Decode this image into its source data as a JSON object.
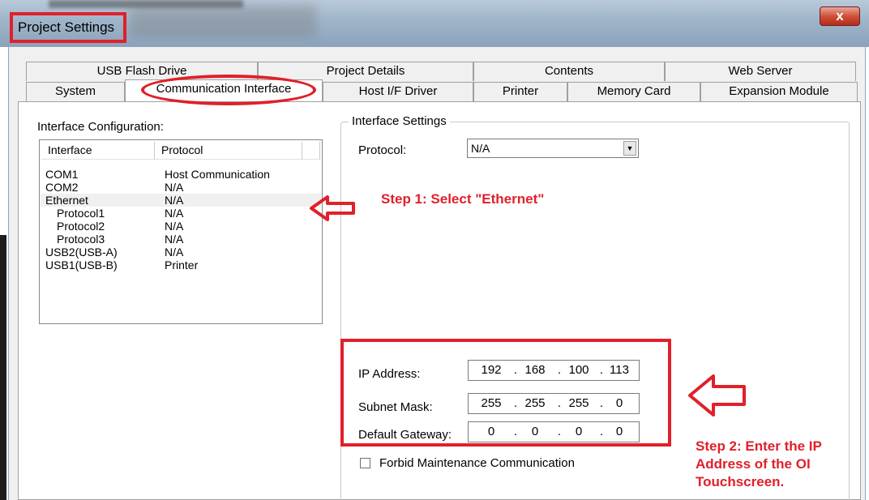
{
  "window": {
    "title": "Project Settings",
    "close_label": "x"
  },
  "tabs_row1": [
    "USB Flash Drive",
    "Project Details",
    "Contents",
    "Web Server"
  ],
  "tabs_row2": [
    "System",
    "Communication Interface",
    "Host I/F Driver",
    "Printer",
    "Memory Card",
    "Expansion Module"
  ],
  "interface_config": {
    "label": "Interface Configuration:",
    "headers": [
      "Interface",
      "Protocol"
    ],
    "rows": [
      {
        "interface": "COM1",
        "protocol": "Host Communication"
      },
      {
        "interface": "COM2",
        "protocol": "N/A"
      },
      {
        "interface": "Ethernet",
        "protocol": "N/A"
      },
      {
        "interface": "Protocol1",
        "protocol": "N/A"
      },
      {
        "interface": "Protocol2",
        "protocol": "N/A"
      },
      {
        "interface": "Protocol3",
        "protocol": "N/A"
      },
      {
        "interface": "USB2(USB-A)",
        "protocol": "N/A"
      },
      {
        "interface": "USB1(USB-B)",
        "protocol": "Printer"
      }
    ]
  },
  "interface_settings": {
    "title": "Interface Settings",
    "protocol_label": "Protocol:",
    "protocol_value": "N/A",
    "ip_label": "IP Address:",
    "ip": [
      "192",
      "168",
      "100",
      "113"
    ],
    "subnet_label": "Subnet Mask:",
    "subnet": [
      "255",
      "255",
      "255",
      "0"
    ],
    "gateway_label": "Default Gateway:",
    "gateway": [
      "0",
      "0",
      "0",
      "0"
    ],
    "forbid_label": "Forbid Maintenance Communication"
  },
  "annotations": {
    "step1": "Step 1:  Select \"Ethernet\"",
    "step2_line1": "Step 2: Enter the IP",
    "step2_line2": "Address of the OI",
    "step2_line3": "Touchscreen."
  },
  "colors": {
    "annotation": "#e0202a"
  }
}
